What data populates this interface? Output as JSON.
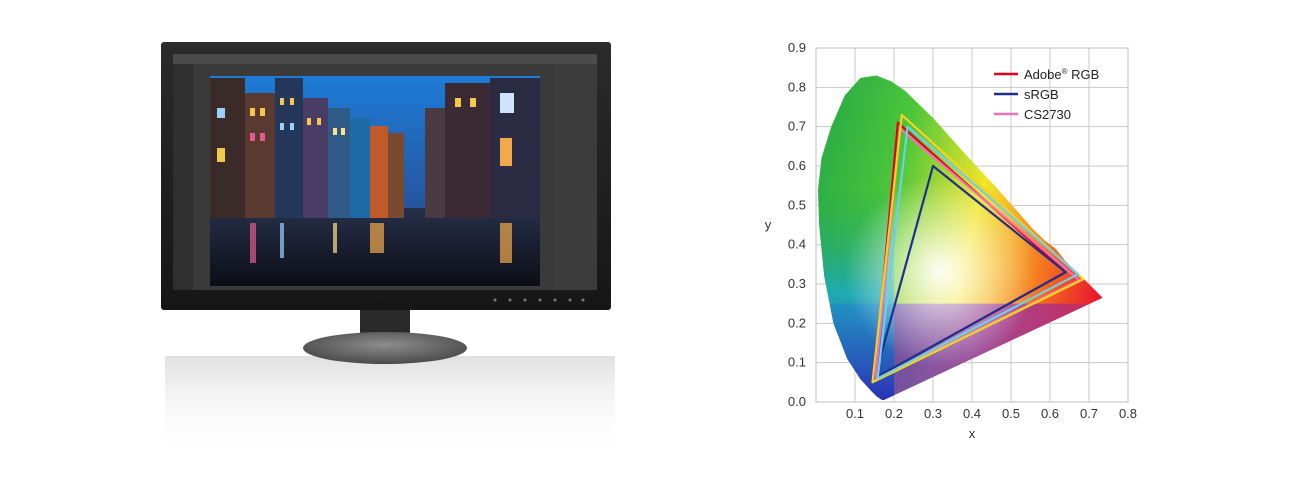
{
  "chart_data": {
    "type": "scatter",
    "title": "",
    "xlabel": "x",
    "ylabel": "y",
    "xlim": [
      0.0,
      0.8
    ],
    "ylim": [
      0.0,
      0.9
    ],
    "x_ticks": [
      "0.1",
      "0.2",
      "0.3",
      "0.4",
      "0.5",
      "0.6",
      "0.7",
      "0.8"
    ],
    "y_ticks": [
      "0.0",
      "0.1",
      "0.2",
      "0.3",
      "0.4",
      "0.5",
      "0.6",
      "0.7",
      "0.8",
      "0.9"
    ],
    "grid": true,
    "legend_position": "top-right",
    "spectral_locus": {
      "x": [
        0.174,
        0.17,
        0.165,
        0.155,
        0.14,
        0.114,
        0.08,
        0.045,
        0.021,
        0.008,
        0.005,
        0.014,
        0.039,
        0.074,
        0.114,
        0.155,
        0.193,
        0.23,
        0.266,
        0.302,
        0.338,
        0.374,
        0.411,
        0.449,
        0.485,
        0.521,
        0.556,
        0.587,
        0.614,
        0.638,
        0.662,
        0.683,
        0.7,
        0.713,
        0.735
      ],
      "y": [
        0.005,
        0.005,
        0.008,
        0.015,
        0.03,
        0.058,
        0.11,
        0.2,
        0.32,
        0.45,
        0.54,
        0.62,
        0.7,
        0.78,
        0.824,
        0.83,
        0.815,
        0.79,
        0.755,
        0.72,
        0.68,
        0.64,
        0.6,
        0.56,
        0.52,
        0.48,
        0.44,
        0.41,
        0.39,
        0.36,
        0.336,
        0.316,
        0.3,
        0.287,
        0.265
      ]
    },
    "series": [
      {
        "name": "Adobe® RGB",
        "color": "#e3001b",
        "x": [
          0.64,
          0.21,
          0.15
        ],
        "y": [
          0.33,
          0.71,
          0.06
        ]
      },
      {
        "name": "sRGB",
        "color": "#1f2e8f",
        "x": [
          0.64,
          0.3,
          0.15
        ],
        "y": [
          0.33,
          0.6,
          0.06
        ]
      },
      {
        "name": "CS2730",
        "color": "#f072b4",
        "x": [
          0.675,
          0.215,
          0.152
        ],
        "y": [
          0.31,
          0.695,
          0.055
        ]
      },
      {
        "name": "",
        "color": "#f5d21f",
        "x": [
          0.685,
          0.22,
          0.145
        ],
        "y": [
          0.312,
          0.73,
          0.05
        ]
      },
      {
        "name": "",
        "color": "#6ed0e8",
        "x": [
          0.672,
          0.235,
          0.158
        ],
        "y": [
          0.325,
          0.7,
          0.06
        ]
      }
    ]
  },
  "legend": [
    {
      "label": "Adobe",
      "superscript": "®",
      "suffix": " RGB",
      "color": "#e3001b"
    },
    {
      "label": "sRGB",
      "superscript": "",
      "suffix": "",
      "color": "#1f2e8f"
    },
    {
      "label": "CS2730",
      "superscript": "",
      "suffix": "",
      "color": "#f072b4"
    }
  ]
}
